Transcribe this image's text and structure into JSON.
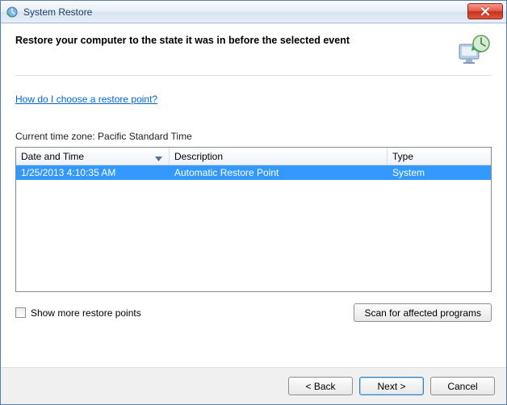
{
  "titlebar": {
    "title": "System Restore"
  },
  "instruction": "Restore your computer to the state it was in before the selected event",
  "help_link": "How do I choose a restore point?",
  "timezone_label": "Current time zone: Pacific Standard Time",
  "table": {
    "headers": {
      "datetime": "Date and Time",
      "description": "Description",
      "type": "Type"
    },
    "rows": [
      {
        "datetime": "1/25/2013 4:10:35 AM",
        "description": "Automatic Restore Point",
        "type": "System",
        "selected": true
      }
    ]
  },
  "show_more_label": "Show more restore points",
  "scan_button": "Scan for affected programs",
  "footer": {
    "back": "< Back",
    "next": "Next >",
    "cancel": "Cancel"
  }
}
